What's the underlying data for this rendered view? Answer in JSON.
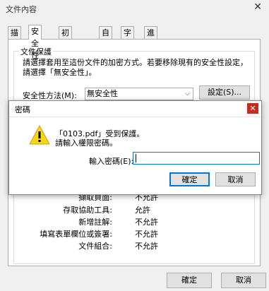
{
  "window": {
    "title": "文件內容",
    "close": "✕"
  },
  "tabs": [
    "描述",
    "安全性",
    "初始檢視",
    "自訂",
    "字型",
    "進階"
  ],
  "security": {
    "group_title": "文件保護",
    "description": "請選擇套用至這份文件的加密方式。若要移除現有的安全性設定，請選擇「無安全性」。",
    "method_label": "安全性方法(M):",
    "method_value": "無安全性",
    "settings_button": "設定(S)..."
  },
  "permissions": [
    {
      "label": "擷取頁面:",
      "value": "不允許"
    },
    {
      "label": "存取協助工具:",
      "value": "允許"
    },
    {
      "label": "新增註解:",
      "value": "不允許"
    },
    {
      "label": "填寫表單欄位或簽署:",
      "value": "不允許"
    },
    {
      "label": "文件組合:",
      "value": "不允許"
    }
  ],
  "footer": {
    "ok": "確定",
    "cancel": "取消"
  },
  "dialog": {
    "title": "密碼",
    "close": "✕",
    "message_line1": "「0103.pdf」受到保護。",
    "message_line2": "請輸入權限密碼。",
    "password_label": "輸入密碼(E):",
    "password_value": "",
    "ok": "確定",
    "cancel": "取消"
  }
}
